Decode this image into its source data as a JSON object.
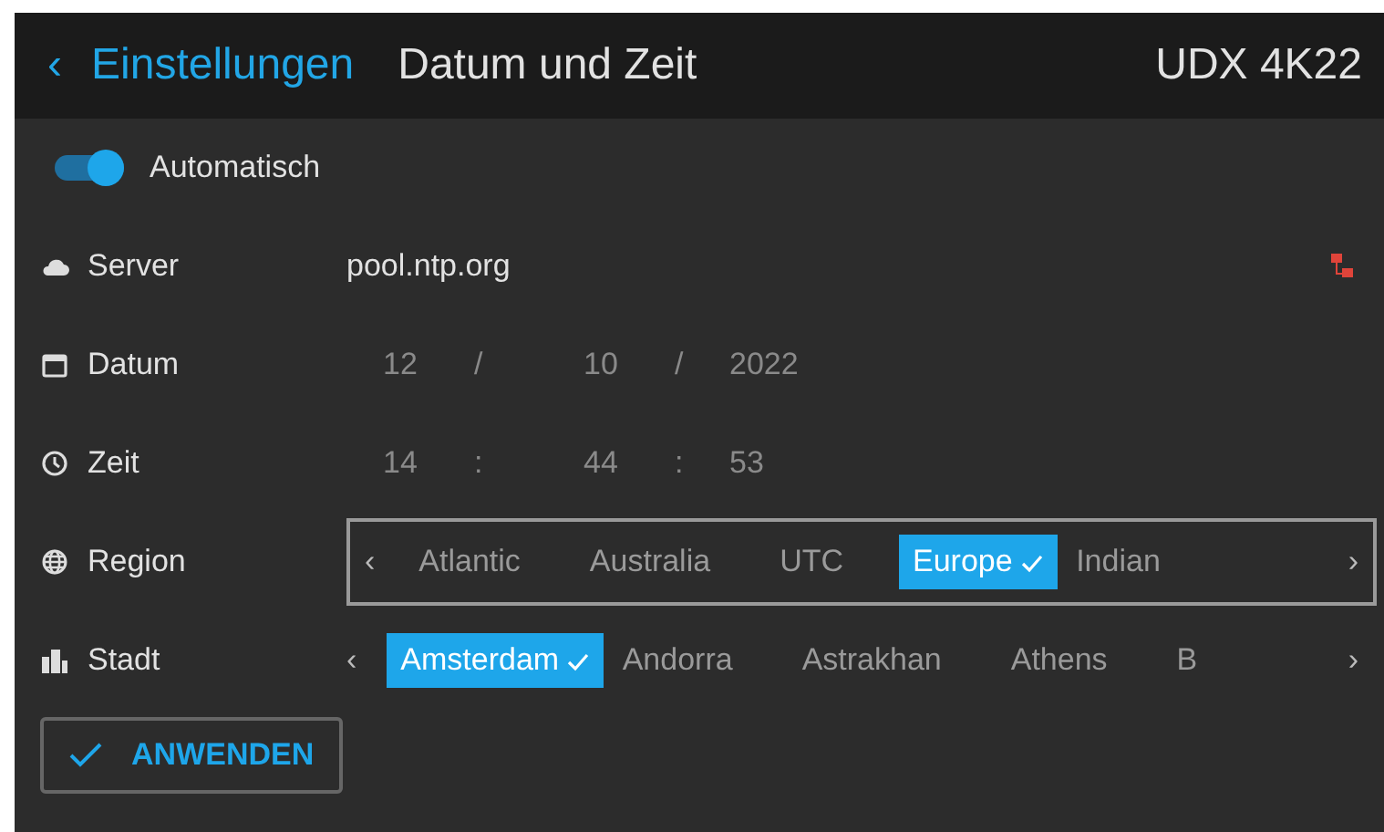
{
  "header": {
    "back_chevron": "‹",
    "back_label": "Einstellungen",
    "title": "Datum und Zeit",
    "device": "UDX 4K22"
  },
  "automatic": {
    "label": "Automatisch",
    "on": true
  },
  "rows": [
    {
      "kind": "text",
      "label": "Server",
      "value": "pool.ntp.org",
      "status_warning": true
    },
    {
      "kind": "parts",
      "label": "Datum",
      "parts": [
        "12",
        "/",
        "10",
        "/",
        "2022"
      ]
    },
    {
      "kind": "parts",
      "label": "Zeit",
      "parts": [
        "14",
        ":",
        "44",
        ":",
        "53"
      ]
    },
    {
      "kind": "selector",
      "label": "Region",
      "focused": true,
      "prev": "‹",
      "next": "›",
      "options": [
        {
          "label": "Atlantic",
          "selected": false
        },
        {
          "label": "Australia",
          "selected": false
        },
        {
          "label": "UTC",
          "selected": false
        },
        {
          "label": "Europe",
          "selected": true
        },
        {
          "label": "Indian",
          "selected": false
        }
      ]
    },
    {
      "kind": "selector",
      "label": "Stadt",
      "focused": false,
      "prev": "‹",
      "next": "›",
      "options": [
        {
          "label": "Amsterdam",
          "selected": true
        },
        {
          "label": "Andorra",
          "selected": false
        },
        {
          "label": "Astrakhan",
          "selected": false
        },
        {
          "label": "Athens",
          "selected": false
        },
        {
          "label": "B",
          "selected": false
        }
      ]
    }
  ],
  "apply_button": "ANWENDEN"
}
